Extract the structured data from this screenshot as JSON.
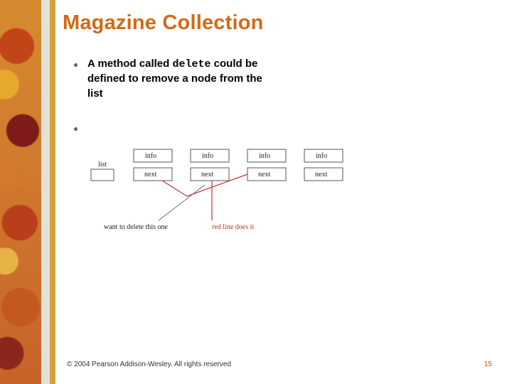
{
  "title": "Magazine Collection",
  "bullets": {
    "b1_pre": "A method called ",
    "b1_code": "delete",
    "b1_post": " could be defined to remove a node from the list"
  },
  "diagram": {
    "list_label": "list",
    "info_label": "info",
    "next_label": "next",
    "caption_black": "want to delete this one",
    "caption_red": "red line does it"
  },
  "footer": "© 2004 Pearson Addison-Wesley. All rights reserved",
  "page_num": "15"
}
